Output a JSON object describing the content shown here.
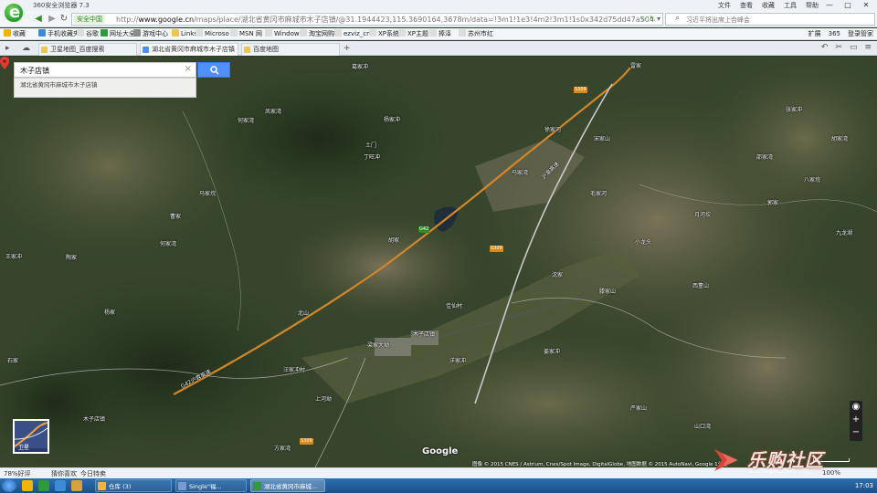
{
  "browser": {
    "app_name": "360安全浏览器 7.3",
    "menus": [
      "文件",
      "查看",
      "收藏",
      "工具",
      "帮助"
    ],
    "security_badge": "安全中国",
    "url_host": "www.google.cn",
    "url_prefix": "http://",
    "url_path": "/maps/place/湖北省黄冈市麻城市木子店镇/@31.1944423,115.3690164,3678m/data=!3m1!1e3!4m2!3m1!1s0x342d75dd47a5044d:0x4371",
    "search_placeholder": "习近平将出席上合峰会"
  },
  "bookmarks": {
    "items": [
      "收藏",
      "手机收藏夹",
      "谷歌",
      "网址大全",
      "游戏中心",
      "Links",
      "Microso",
      "MSN 网",
      "Window",
      "淘宝网购",
      "ezviz_cn",
      "XP系统",
      "XP主题",
      "捧泽",
      "苏州市红"
    ],
    "right": [
      "扩展",
      "365",
      "登录管家"
    ]
  },
  "tabs": [
    {
      "label": "卫星地图_百度搜索",
      "active": false
    },
    {
      "label": "湖北省黄冈市麻城市木子店镇 -",
      "active": true
    },
    {
      "label": "百度地图",
      "active": false
    }
  ],
  "map": {
    "search_value": "木子店镇",
    "suggestion": "湖北省黄冈市麻城市木子店镇",
    "place_label": "木子店镇",
    "labels": [
      "葛家冲",
      "凤家湾",
      "何家湾",
      "土门",
      "丁旺冲",
      "马家垸",
      "曹家",
      "何家湾",
      "王家冲",
      "陶家",
      "杨家",
      "石家",
      "杨家冲",
      "徐家河",
      "宋家山",
      "马家湾",
      "毛家河",
      "雷家",
      "张家冲",
      "胡家湾",
      "邵家湾",
      "八家垸",
      "月河坎",
      "郭家",
      "九龙湖",
      "小龙头",
      "胡家",
      "沈家",
      "西董山",
      "滕家山",
      "佳仙村",
      "北山",
      "梁家大坳",
      "前方畈",
      "汪家冲村",
      "洋家冲",
      "姜家冲",
      "上河坳",
      "木子店镇",
      "方家湾",
      "山口湾",
      "严家山",
      "汪家畈",
      "下畈",
      "王家大湾",
      "天寨山",
      "龙伏湾",
      "马家冲",
      "余家冲",
      "刘家湾",
      "庙岗",
      "杨家大湾",
      "桃花寨",
      "龙王庙",
      "中屯",
      "新屋",
      "仙居",
      "高家",
      "潘家畈",
      "丁家畈",
      "雷家湾",
      "黄石庄",
      "姑嫂冲",
      "李家",
      "马家",
      "天堂山",
      "刘家山",
      "汪家",
      "赵家",
      "王家畈",
      "曹家坳",
      "汤家畈",
      "宋家"
    ],
    "road_badges": [
      "S309",
      "S309",
      "S309",
      "G42"
    ],
    "highway_label": "沪渝高速",
    "highway_label_2": "G42沪蓉高速",
    "sat_label": "卫星",
    "google": "Google",
    "attribution": "图像 © 2015 CNES / Astrium, Cnes/Spot Image, DigitalGlobe, 地图数据 © 2015 AutoNavi, Google   1公里",
    "zoom_in": "+",
    "zoom_out": "−"
  },
  "watermark": {
    "text": "乐购社区",
    "sub": "bbs.lagou.com"
  },
  "statusbar": {
    "items": [
      "78%好评",
      "猜你喜欢",
      "今日特卖"
    ],
    "zoom": "100%"
  },
  "taskbar": {
    "tasks": [
      {
        "label": "仓库 (3)",
        "color": "#f2b53a"
      },
      {
        "label": "Single\"福...",
        "color": "#7a9ad6"
      },
      {
        "label": "湖北省黄冈市麻城...",
        "color": "#2e9a3b"
      }
    ],
    "clock": "17:03"
  },
  "colors": {
    "accent": "#4d90fe",
    "browser_green": "#2e8b25",
    "road": "#d88a1a"
  }
}
